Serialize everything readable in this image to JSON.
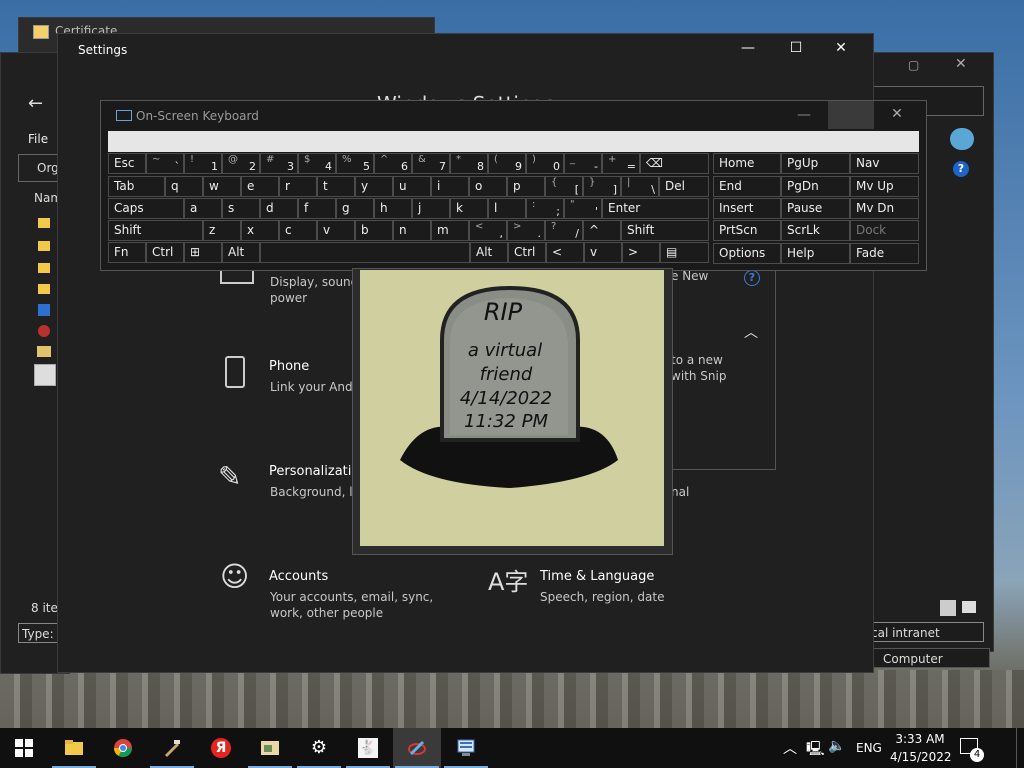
{
  "background_windows": {
    "certificate_title": "Certificate",
    "explorer": {
      "file_menu": "File",
      "organize": "Org",
      "name_header": "Nam",
      "item_count": "8 ite",
      "type_label": "Type: A"
    },
    "ie": {
      "zone_text": "cal intranet",
      "computer_text": "Computer"
    }
  },
  "settings": {
    "title": "Settings",
    "heading": "Windows Settings",
    "tiles": [
      {
        "title": "",
        "subtitle": "Display, sound,\npower",
        "icon": "system-icon"
      },
      {
        "title": "Phone",
        "subtitle": "Link your Andro",
        "icon": "phone-icon"
      },
      {
        "title": "Personalizatio",
        "subtitle": "Background, loc",
        "icon": "personalization-icon"
      },
      {
        "title": "Accounts",
        "subtitle": "Your accounts, email, sync,\nwork, other people",
        "icon": "accounts-icon"
      },
      {
        "title": "Time & Language",
        "subtitle": "Speech, region, date",
        "icon": "time-language-icon"
      }
    ],
    "right_snippets": {
      "new_text": "e New",
      "snip_text": "to a new\nwith Snip",
      "nal_text": "nal"
    }
  },
  "osk": {
    "title": "On-Screen Keyboard",
    "rows": [
      [
        {
          "label": "Esc"
        },
        {
          "label": "~",
          "sub": "`"
        },
        {
          "label": "!",
          "sub": "1"
        },
        {
          "label": "@",
          "sub": "2"
        },
        {
          "label": "#",
          "sub": "3"
        },
        {
          "label": "$",
          "sub": "4"
        },
        {
          "label": "%",
          "sub": "5"
        },
        {
          "label": "^",
          "sub": "6"
        },
        {
          "label": "&",
          "sub": "7"
        },
        {
          "label": "*",
          "sub": "8"
        },
        {
          "label": "(",
          "sub": "9"
        },
        {
          "label": ")",
          "sub": "0"
        },
        {
          "label": "_",
          "sub": "-"
        },
        {
          "label": "+",
          "sub": "="
        },
        {
          "label": "⌫"
        }
      ],
      [
        {
          "label": "Tab"
        },
        {
          "label": "q"
        },
        {
          "label": "w"
        },
        {
          "label": "e"
        },
        {
          "label": "r"
        },
        {
          "label": "t"
        },
        {
          "label": "y"
        },
        {
          "label": "u"
        },
        {
          "label": "i"
        },
        {
          "label": "o"
        },
        {
          "label": "p"
        },
        {
          "label": "{",
          "sub": "["
        },
        {
          "label": "}",
          "sub": "]"
        },
        {
          "label": "|",
          "sub": "\\"
        },
        {
          "label": "Del"
        }
      ],
      [
        {
          "label": "Caps"
        },
        {
          "label": "a"
        },
        {
          "label": "s"
        },
        {
          "label": "d"
        },
        {
          "label": "f"
        },
        {
          "label": "g"
        },
        {
          "label": "h"
        },
        {
          "label": "j"
        },
        {
          "label": "k"
        },
        {
          "label": "l"
        },
        {
          "label": ":",
          "sub": ";"
        },
        {
          "label": "\"",
          "sub": "'"
        },
        {
          "label": "Enter"
        }
      ],
      [
        {
          "label": "Shift"
        },
        {
          "label": "z"
        },
        {
          "label": "x"
        },
        {
          "label": "c"
        },
        {
          "label": "v"
        },
        {
          "label": "b"
        },
        {
          "label": "n"
        },
        {
          "label": "m"
        },
        {
          "label": "<",
          "sub": ","
        },
        {
          "label": ">",
          "sub": "."
        },
        {
          "label": "?",
          "sub": "/"
        },
        {
          "label": "^"
        },
        {
          "label": "Shift"
        }
      ],
      [
        {
          "label": "Fn"
        },
        {
          "label": "Ctrl"
        },
        {
          "label": "⊞"
        },
        {
          "label": "Alt"
        },
        {
          "label": ""
        },
        {
          "label": "Alt"
        },
        {
          "label": "Ctrl"
        },
        {
          "label": "<"
        },
        {
          "label": "v"
        },
        {
          "label": ">"
        },
        {
          "label": "▤"
        }
      ]
    ],
    "nav_keys": [
      [
        "Home",
        "PgUp",
        "Nav"
      ],
      [
        "End",
        "PgDn",
        "Mv Up"
      ],
      [
        "Insert",
        "Pause",
        "Mv Dn"
      ],
      [
        "PrtScn",
        "ScrLk",
        "Dock"
      ],
      [
        "Options",
        "Help",
        "Fade"
      ]
    ]
  },
  "tombstone": {
    "line1": "RIP",
    "line2": "a virtual",
    "line3": "friend",
    "line4": "4/14/2022",
    "line5": "11:32 PM"
  },
  "taskbar": {
    "apps": [
      "start-icon",
      "file-explorer-icon",
      "chrome-icon",
      "tool-icon",
      "yandex-icon",
      "image-viewer-icon",
      "settings-icon",
      "rabbit-app-icon",
      "paint-icon",
      "network-app-icon"
    ],
    "yandex_letter": "Я",
    "language": "ENG",
    "time": "3:33 AM",
    "date": "4/15/2022",
    "notification_count": "4"
  },
  "colors": {
    "window_bg": "#202020",
    "accent": "#1e64c8",
    "tomb_bg": "#cfcf9f"
  }
}
